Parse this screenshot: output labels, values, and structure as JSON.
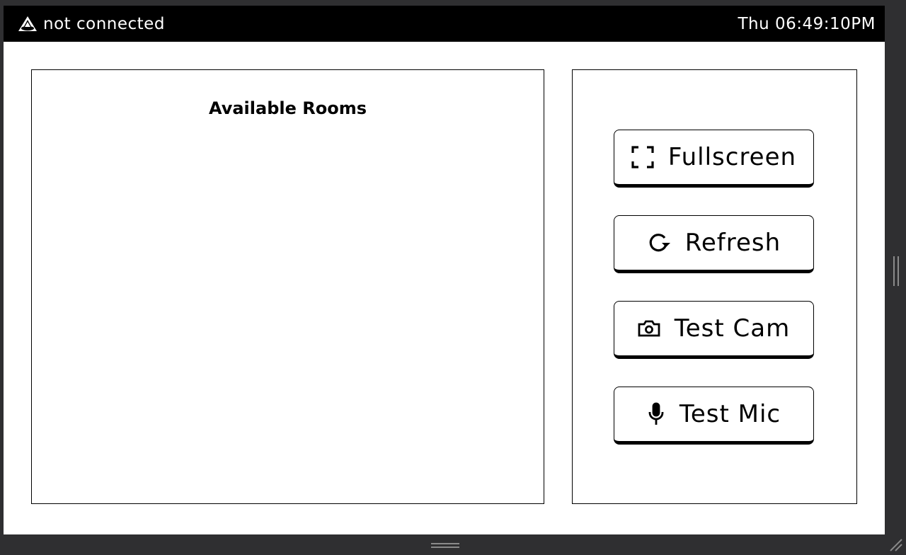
{
  "status_bar": {
    "connection_icon": "cone-logo-icon",
    "connection_text": "not connected",
    "clock": "Thu 06:49:10PM"
  },
  "rooms": {
    "title": "Available Rooms",
    "items": []
  },
  "actions": [
    {
      "label": "Fullscreen",
      "icon": "fullscreen-icon"
    },
    {
      "label": "Refresh",
      "icon": "refresh-icon"
    },
    {
      "label": "Test Cam",
      "icon": "camera-icon"
    },
    {
      "label": "Test Mic",
      "icon": "microphone-icon"
    }
  ],
  "colors": {
    "bar_background": "#000000",
    "bar_text": "#ffffff",
    "page_background": "#ffffff",
    "outer_background": "#2f2f31"
  }
}
